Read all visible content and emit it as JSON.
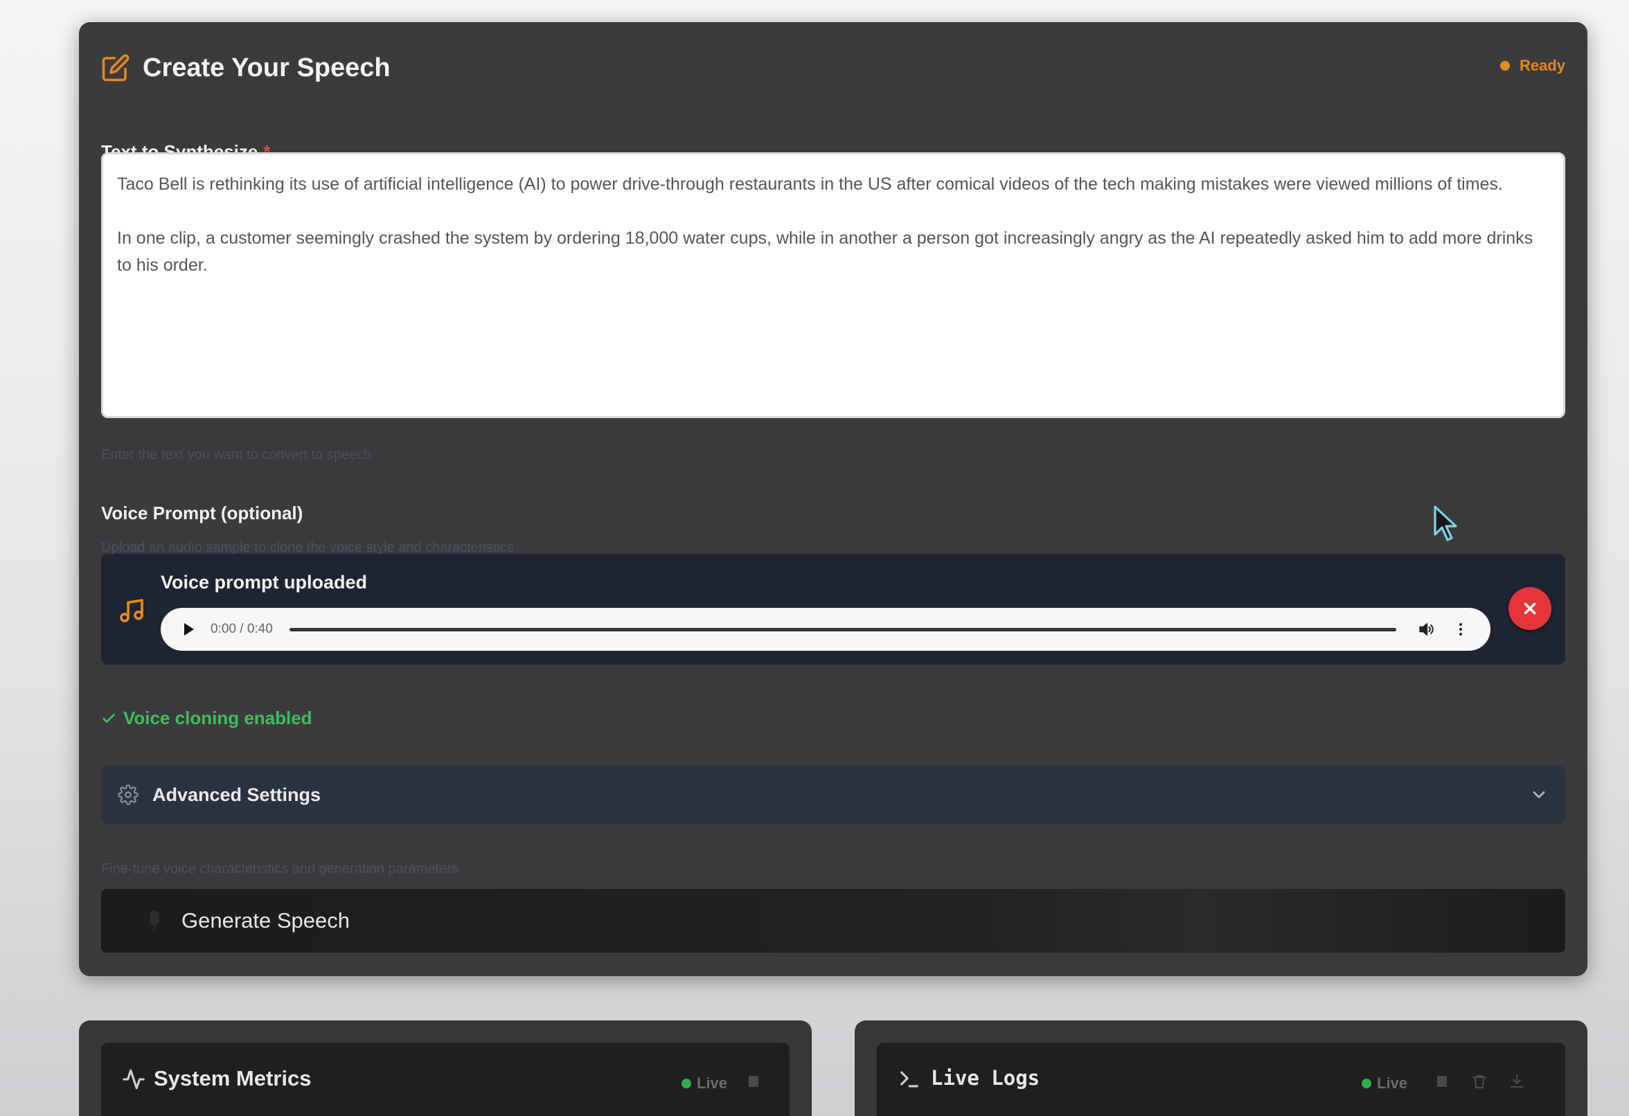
{
  "header": {
    "title": "Create Your Speech",
    "status": "Ready",
    "accent_color": "#e58a1e"
  },
  "text_field": {
    "label": "Text to Synthesize",
    "required_mark": "*",
    "paragraph_1": "Taco Bell is rethinking its use of artificial intelligence (AI) to power drive-through restaurants in the US after comical videos of the tech making mistakes were viewed millions of times.",
    "paragraph_2": "In one clip, a customer seemingly crashed the system by ordering 18,000 water cups, while in another a person got increasingly angry as the AI repeatedly asked him to add more drinks to his order.",
    "hint": "Enter the text you want to convert to speech"
  },
  "voice_prompt": {
    "label": "Voice Prompt (optional)",
    "hint": "Upload an audio sample to clone the voice style and characteristics",
    "uploaded_title": "Voice prompt uploaded",
    "audio": {
      "time": "0:00 / 0:40",
      "progress": 0
    },
    "cloning_status": "Voice cloning enabled",
    "cloning_color": "#3fbf5a"
  },
  "advanced": {
    "label": "Advanced Settings",
    "hint": "Fine-tune voice characteristics and generation parameters"
  },
  "generate": {
    "label": "Generate Speech"
  },
  "metrics": {
    "title": "System Metrics",
    "live": "Live"
  },
  "logs": {
    "title": "Live Logs",
    "live": "Live"
  },
  "icons": {
    "header": "edit-icon",
    "music": "music-note-icon",
    "play": "play-icon",
    "volume": "volume-icon",
    "more": "more-vertical-icon",
    "remove": "close-icon",
    "check": "check-icon",
    "gear": "gear-icon",
    "chevron": "chevron-down-icon",
    "mic": "microphone-icon",
    "activity": "activity-icon",
    "terminal": "terminal-icon",
    "pause": "pause-icon",
    "trash": "trash-icon",
    "download": "download-icon"
  }
}
